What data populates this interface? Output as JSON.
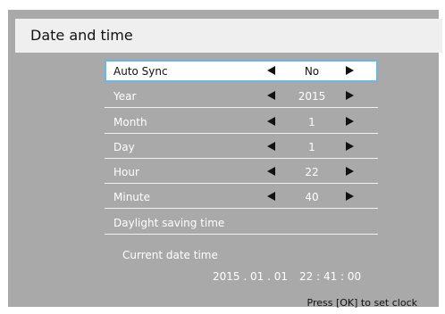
{
  "title": "Date and time",
  "rows": {
    "auto_sync": {
      "label": "Auto Sync",
      "value": "No"
    },
    "year": {
      "label": "Year",
      "value": "2015"
    },
    "month": {
      "label": "Month",
      "value": "1"
    },
    "day": {
      "label": "Day",
      "value": "1"
    },
    "hour": {
      "label": "Hour",
      "value": "22"
    },
    "minute": {
      "label": "Minute",
      "value": "40"
    },
    "daylight": {
      "label": "Daylight saving time"
    }
  },
  "current": {
    "label": "Current date time",
    "date": "2015 . 01 . 01",
    "time": "22 : 41 : 00"
  },
  "hint": "Press [OK] to set clock",
  "colors": {
    "background": "#a9a9a9",
    "title_bar": "#efefef",
    "selection_border": "#6ab7e6"
  },
  "icons": {
    "decrease": "triangle-left-icon",
    "increase": "triangle-right-icon"
  }
}
